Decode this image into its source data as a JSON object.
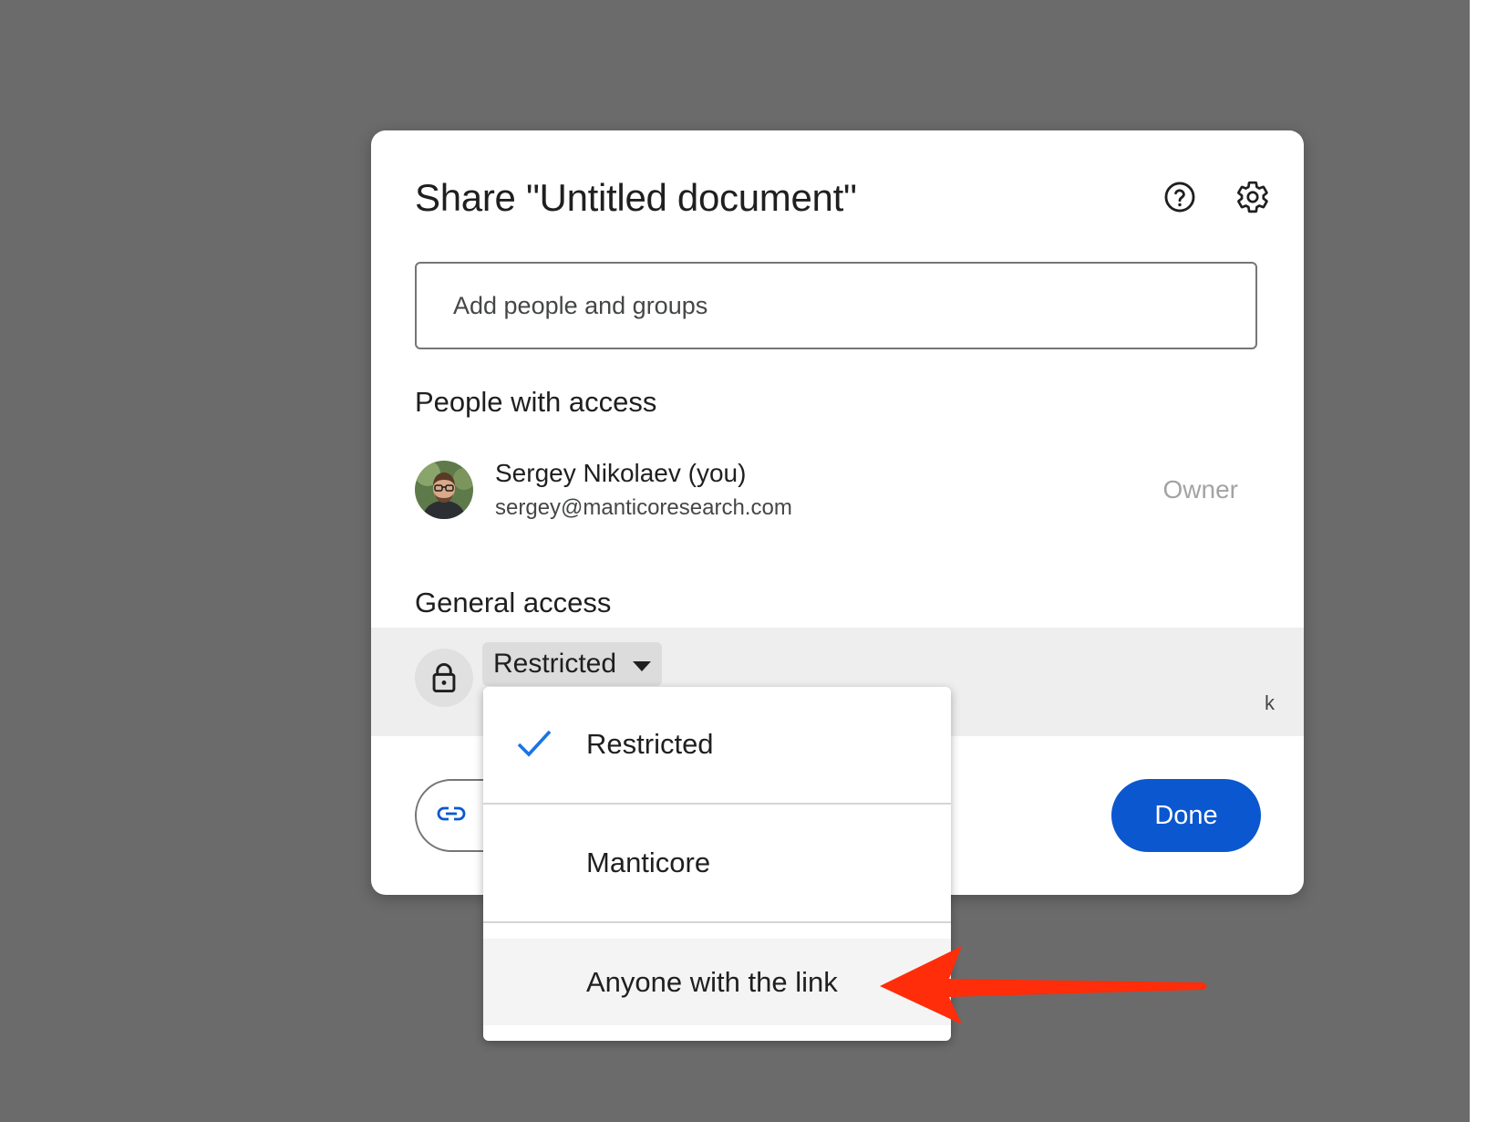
{
  "dialog": {
    "title": "Share \"Untitled document\"",
    "help_icon": "help-circle-icon",
    "settings_icon": "gear-icon"
  },
  "add_people": {
    "placeholder": "Add people and groups",
    "value": ""
  },
  "people_with_access": {
    "heading": "People with access",
    "users": [
      {
        "name": "Sergey Nikolaev (you)",
        "email": "sergey@manticoresearch.com",
        "role": "Owner"
      }
    ]
  },
  "general_access": {
    "heading": "General access",
    "selected": "Restricted",
    "description_fragment": "k",
    "lock_icon": "lock-icon"
  },
  "dropdown_menu": {
    "items": [
      {
        "label": "Restricted",
        "checked": true
      },
      {
        "label": "Manticore",
        "checked": false
      },
      {
        "label": "Anyone with the link",
        "checked": false,
        "highlighted": true
      }
    ]
  },
  "footer": {
    "copy_link_icon": "link-icon",
    "done_label": "Done"
  },
  "annotation": {
    "arrow_color": "#ff2d0a"
  },
  "colors": {
    "primary": "#0b57d0",
    "check": "#1a73e8",
    "overlay": "#6b6b6b"
  }
}
